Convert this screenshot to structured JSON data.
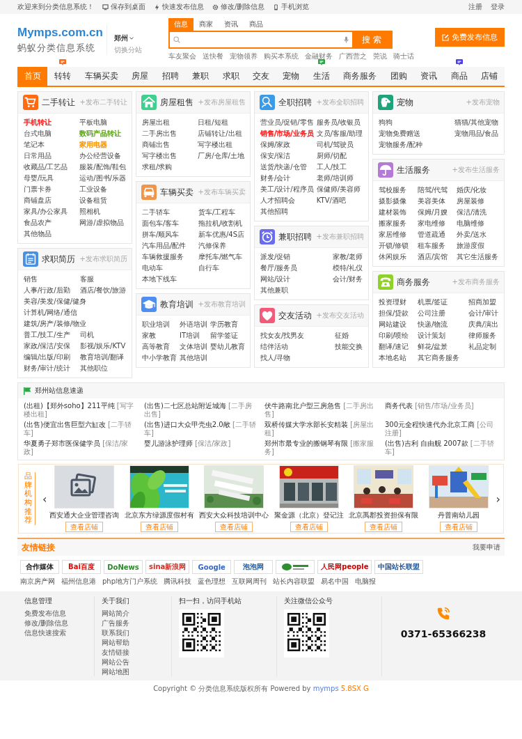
{
  "top_bar": {
    "welcome": "欢迎来到分类信息系统！",
    "links": [
      {
        "label": "保存到桌面"
      },
      {
        "label": "快速发布信息"
      },
      {
        "label": "修改/删除信息"
      },
      {
        "label": "手机浏览"
      }
    ],
    "account": [
      "注册",
      "登录"
    ]
  },
  "header": {
    "logo": "Mymps.com.cn",
    "tagline": "蚂蚁分类信息系统",
    "city": "郑州",
    "switch_city": "切换分站",
    "search": {
      "tabs": [
        {
          "label": "信息",
          "selected": true
        },
        {
          "label": "商家",
          "selected": false
        },
        {
          "label": "资讯",
          "selected": false
        },
        {
          "label": "商品",
          "selected": false
        }
      ],
      "button": "搜 索",
      "hot_words": [
        "车友聚会",
        "送快餐",
        "宠物领养",
        "购买本系统",
        "金融财务",
        "广西营之",
        "莞说",
        "骑士话"
      ]
    },
    "post_button": "免费发布信息"
  },
  "nav": [
    {
      "label": "首页",
      "selected": true
    },
    {
      "label": "转转",
      "selected": false,
      "badge": {
        "color": "#ff6a13"
      }
    },
    {
      "label": "车辆买卖",
      "selected": false
    },
    {
      "label": "房屋",
      "selected": false
    },
    {
      "label": "招聘",
      "selected": false
    },
    {
      "label": "兼职",
      "selected": false
    },
    {
      "label": "求职",
      "selected": false
    },
    {
      "label": "交友",
      "selected": false
    },
    {
      "label": "宠物",
      "selected": false
    },
    {
      "label": "生活",
      "selected": false,
      "badge": {
        "color": "#2aa845"
      }
    },
    {
      "label": "商务服务",
      "selected": false
    },
    {
      "label": "团购",
      "selected": false
    },
    {
      "label": "资讯",
      "selected": false
    },
    {
      "label": "商品",
      "selected": false,
      "badge": {
        "color": "#4b3ff0"
      }
    },
    {
      "label": "店铺",
      "selected": false
    }
  ],
  "category_columns": [
    {
      "cards": [
        {
          "title": "二手转让",
          "post_link": "+发布二手转让",
          "color": "#ff6a13",
          "kind": "two_column",
          "items": [
            {
              "label": "手机转让",
              "color": "#ff2020"
            },
            {
              "label": "平板电脑"
            },
            {
              "label": "台式电脑"
            },
            {
              "label": "数码产品转让",
              "color": "#66aa22"
            },
            {
              "label": "笔记本"
            },
            {
              "label": "家用电器",
              "color": "#ff9900"
            },
            {
              "label": "日常用品"
            },
            {
              "label": "办公经营设备"
            },
            {
              "label": "收藏品/工艺品"
            },
            {
              "label": "服装/配饰/鞋包"
            },
            {
              "label": "母婴/玩具"
            },
            {
              "label": "运动/图书/乐器"
            },
            {
              "label": "门票卡券"
            },
            {
              "label": "工业设备"
            },
            {
              "label": "商铺盘店"
            },
            {
              "label": "设备租赁"
            },
            {
              "label": "家具/办公家具"
            },
            {
              "label": "照相机"
            },
            {
              "label": "食品农产"
            },
            {
              "label": "网游/虚拟物品"
            },
            {
              "label": "其他物品"
            }
          ]
        },
        {
          "title": "求职简历",
          "post_link": "+发布求职简历",
          "color": "#4a90e2",
          "kind": "two_column",
          "items": [
            {
              "label": "销售"
            },
            {
              "label": "客服"
            },
            {
              "label": "人事/行政/后勤"
            },
            {
              "label": "酒店/餐饮/旅游"
            },
            {
              "label": "美容/美发/保健/健身"
            },
            {
              "label": "计算机/网络/通信"
            },
            {
              "label": "建筑/房产/装修/物业"
            },
            {
              "label": "普工/技工/生产"
            },
            {
              "label": "司机"
            },
            {
              "label": "家政/保洁/安保"
            },
            {
              "label": "影视/娱乐/KTV"
            },
            {
              "label": "编辑/出版/印刷"
            },
            {
              "label": "教育培训/翻译"
            },
            {
              "label": "财务/审计/统计"
            },
            {
              "label": "其他职位"
            }
          ]
        }
      ]
    },
    {
      "cards": [
        {
          "title": "房屋租售",
          "post_link": "+发布房屋租售",
          "color": "#3fcf8e",
          "kind": "two_column",
          "items": [
            {
              "label": "房屋出租"
            },
            {
              "label": "日租/短租"
            },
            {
              "label": "二手房出售"
            },
            {
              "label": "店铺转让/出租"
            },
            {
              "label": "商铺出售"
            },
            {
              "label": "写字楼出租"
            },
            {
              "label": "写字楼出售"
            },
            {
              "label": "厂房/仓库/土地"
            },
            {
              "label": "求租/求购"
            }
          ]
        },
        {
          "title": "车辆买卖",
          "post_link": "+发布车辆买卖",
          "color": "#f0954a",
          "kind": "two_column",
          "items": [
            {
              "label": "二手轿车"
            },
            {
              "label": "货车/工程车"
            },
            {
              "label": "面包车/客车"
            },
            {
              "label": "拖拉机/收割机"
            },
            {
              "label": "拼车/顺风车"
            },
            {
              "label": "新车优惠/4S店"
            },
            {
              "label": "汽车用品/配件"
            },
            {
              "label": "汽修保养"
            },
            {
              "label": "车辆救援服务"
            },
            {
              "label": "摩托车/燃气车"
            },
            {
              "label": "电动车"
            },
            {
              "label": "自行车"
            },
            {
              "label": "本地下线车"
            }
          ]
        },
        {
          "title": "教育培训",
          "post_link": "+发布教育培训",
          "color": "#4f8ef0",
          "kind": "three_column",
          "items": [
            {
              "label": "职业培训"
            },
            {
              "label": "外语培训"
            },
            {
              "label": "学历教育"
            },
            {
              "label": "家教"
            },
            {
              "label": "IT培训"
            },
            {
              "label": "留学签证"
            },
            {
              "label": "高等教育"
            },
            {
              "label": "文体培训"
            },
            {
              "label": "婴幼儿教育"
            },
            {
              "label": "中小学教育"
            },
            {
              "label": "其他培训"
            }
          ]
        }
      ]
    },
    {
      "cards": [
        {
          "title": "全职招聘",
          "post_link": "+发布全职招聘",
          "color": "#3a9be8",
          "kind": "two_column",
          "items": [
            {
              "label": "营业员/促销/零售"
            },
            {
              "label": "服务员/收银员"
            },
            {
              "label": "销售/市场/业务员",
              "color": "#ff2020"
            },
            {
              "label": "文员/客服/助理"
            },
            {
              "label": "保姆/家政"
            },
            {
              "label": "司机/驾驶员"
            },
            {
              "label": "保安/保洁"
            },
            {
              "label": "厨师/切配"
            },
            {
              "label": "送货/快递/仓管"
            },
            {
              "label": "工人/技工"
            },
            {
              "label": "财务/会计"
            },
            {
              "label": "老师/培训师"
            },
            {
              "label": "美工/设计/程序员"
            },
            {
              "label": "保健师/美容师"
            },
            {
              "label": "人才招聘会"
            },
            {
              "label": "KTV/酒吧"
            },
            {
              "label": "其他招聘"
            }
          ]
        },
        {
          "title": "兼职招聘",
          "post_link": "+发布兼职招聘",
          "color": "#6a6cf0",
          "kind": "two_column",
          "items": [
            {
              "label": "派发/促销"
            },
            {
              "label": "家教/老师"
            },
            {
              "label": "餐厅/服务员"
            },
            {
              "label": "模特/礼仪"
            },
            {
              "label": "网站/设计"
            },
            {
              "label": "会计/财务"
            },
            {
              "label": "其他兼职"
            }
          ]
        },
        {
          "title": "交友活动",
          "post_link": "+发布交友活动",
          "color": "#f25a7a",
          "kind": "two_column",
          "items": [
            {
              "label": "找女友/找男友"
            },
            {
              "label": "征婚"
            },
            {
              "label": "结伴活动"
            },
            {
              "label": "技能交换"
            },
            {
              "label": "找人/寻物"
            }
          ]
        }
      ]
    },
    {
      "cards": [
        {
          "title": "宠物",
          "post_link": "+发布宠物",
          "color": "#1fa37a",
          "kind": "two_column",
          "items": [
            {
              "label": "狗狗"
            },
            {
              "label": "猫猫/其他宠物"
            },
            {
              "label": "宠物免费赠送"
            },
            {
              "label": "宠物用品/食品"
            },
            {
              "label": "宠物服务/配种"
            }
          ]
        },
        {
          "title": "生活服务",
          "post_link": "+发布生活服务",
          "color": "#b57ad6",
          "kind": "three_column",
          "items": [
            {
              "label": "驾校服务"
            },
            {
              "label": "陪驾/代驾"
            },
            {
              "label": "婚庆/化妆"
            },
            {
              "label": "摄影摄像"
            },
            {
              "label": "美容美体"
            },
            {
              "label": "房屋装修"
            },
            {
              "label": "建材装饰"
            },
            {
              "label": "保姆/月嫂"
            },
            {
              "label": "保洁/清洗"
            },
            {
              "label": "搬家服务"
            },
            {
              "label": "家电维修"
            },
            {
              "label": "电脑维修"
            },
            {
              "label": "家居维修"
            },
            {
              "label": "管道疏通"
            },
            {
              "label": "外卖/送水"
            },
            {
              "label": "开锁/修锁"
            },
            {
              "label": "租车服务"
            },
            {
              "label": "旅游度假"
            },
            {
              "label": "休闲娱乐"
            },
            {
              "label": "酒店/宾馆"
            },
            {
              "label": "其它生活服务"
            }
          ]
        },
        {
          "title": "商务服务",
          "post_link": "+发布商务服务",
          "color": "#8fd12a",
          "kind": "three_column",
          "items": [
            {
              "label": "投资理财"
            },
            {
              "label": "机票/签证"
            },
            {
              "label": "招商加盟"
            },
            {
              "label": "担保/贷款"
            },
            {
              "label": "公司注册"
            },
            {
              "label": "会计/审计"
            },
            {
              "label": "网站建设"
            },
            {
              "label": "快递/物流"
            },
            {
              "label": "庆典/演出"
            },
            {
              "label": "印刷/喷绘"
            },
            {
              "label": "设计策划"
            },
            {
              "label": "律师服务"
            },
            {
              "label": "翻译/速记"
            },
            {
              "label": "鲜花/盆景"
            },
            {
              "label": "礼品定制"
            },
            {
              "label": "本地名站"
            },
            {
              "label": "其它商务服务"
            }
          ]
        }
      ]
    }
  ],
  "news": {
    "title": "郑州站信息速递",
    "items": [
      {
        "title": "(出租)【郑外soho】211平纯",
        "tag": "[写字楼出租]"
      },
      {
        "title": "(出售)二七区总站附近城海",
        "tag": "[二手房出售]"
      },
      {
        "title": "伏牛路南北户型三房急售",
        "tag": "[二手房出售]"
      },
      {
        "title": "商务代表",
        "tag": "[销售/市场/业务员]"
      },
      {
        "title": "(出售)便宜出售巨型六缸改",
        "tag": "[二手轿车]"
      },
      {
        "title": "(出售)进口大众甲壳虫2.0敞",
        "tag": "[二手轿车]"
      },
      {
        "title": "双桥传媒大学水部长安精装",
        "tag": "[房屋出租]"
      },
      {
        "title": "300元全程快速代办北京工商",
        "tag": "[公司注册]"
      },
      {
        "title": "华夏勇子郑市医保健学员",
        "tag": "[保洁/家政]"
      },
      {
        "title": "婴儿游泳护理师",
        "tag": "[保洁/家政]"
      },
      {
        "title": "郑州市最专业的搬钢琴有限",
        "tag": "[搬家服务]"
      },
      {
        "title": "(出售)吉利 自由舰 2007款",
        "tag": "[二手轿车]"
      }
    ]
  },
  "brands": {
    "title": "品牌机构推荐",
    "previous": "‹",
    "next": "›",
    "items": [
      {
        "name": "西安通大企业管理咨询",
        "button": "查看店铺",
        "kind": "placeholder"
      },
      {
        "name": "北京东方绿源度假村有",
        "button": "查看店铺",
        "kind": "picture"
      },
      {
        "name": "西安大众科技培训中心",
        "button": "查看店铺",
        "kind": "picture"
      },
      {
        "name": "聚金源（北京）登记注",
        "button": "查看店铺",
        "kind": "picture"
      },
      {
        "name": "北京禹郡投资担保有限",
        "button": "查看店铺",
        "kind": "picture"
      },
      {
        "name": "丹普南幼儿园",
        "button": "查看店铺",
        "kind": "picture"
      }
    ]
  },
  "friend_links": {
    "title": "友情链接",
    "apply": "我要申请",
    "logos": [
      {
        "text": "合作媒体",
        "color": "#222222"
      },
      {
        "text": "Bai百度",
        "color": "#e10602"
      },
      {
        "text": "DoNews",
        "color": "#2a8a2a"
      },
      {
        "text": "sina新浪网",
        "color": "#d52b1e"
      },
      {
        "text": "Google",
        "color": "#3366cc"
      },
      {
        "text": "泡泡网",
        "color": "#1d5fa8"
      },
      {
        "color": "#2f8f2f"
      },
      {
        "text": "人民网people",
        "color": "#d00000"
      },
      {
        "text": "中国站长联盟",
        "color": "#1a5aa8"
      }
    ],
    "text_links": [
      "南京房产网",
      "福州信息港",
      "php地方门户系统",
      "腾讯科技",
      "蓝色理想",
      "互联网周刊",
      "站长内容联盟",
      "易名中国",
      "电脑报"
    ]
  },
  "footer": {
    "columns": [
      {
        "title": "信息管理",
        "items": [
          "免费发布信息",
          "修改/删除信息",
          "信息快速搜索"
        ]
      },
      {
        "title": "关于我们",
        "items": [
          "网站简介",
          "广告服务",
          "联系我们",
          "网站帮助",
          "友情链接",
          "网站公告",
          "网站地图"
        ]
      }
    ],
    "qr_codes": [
      {
        "title": "扫一扫，访问手机站"
      },
      {
        "title": "关注微信公众号"
      }
    ],
    "phone": "0371-65366238",
    "copyright": "Copyright © 分类信息系统版权所有 Powered by",
    "powered_by": "mymps",
    "version": "5.8SX G"
  }
}
